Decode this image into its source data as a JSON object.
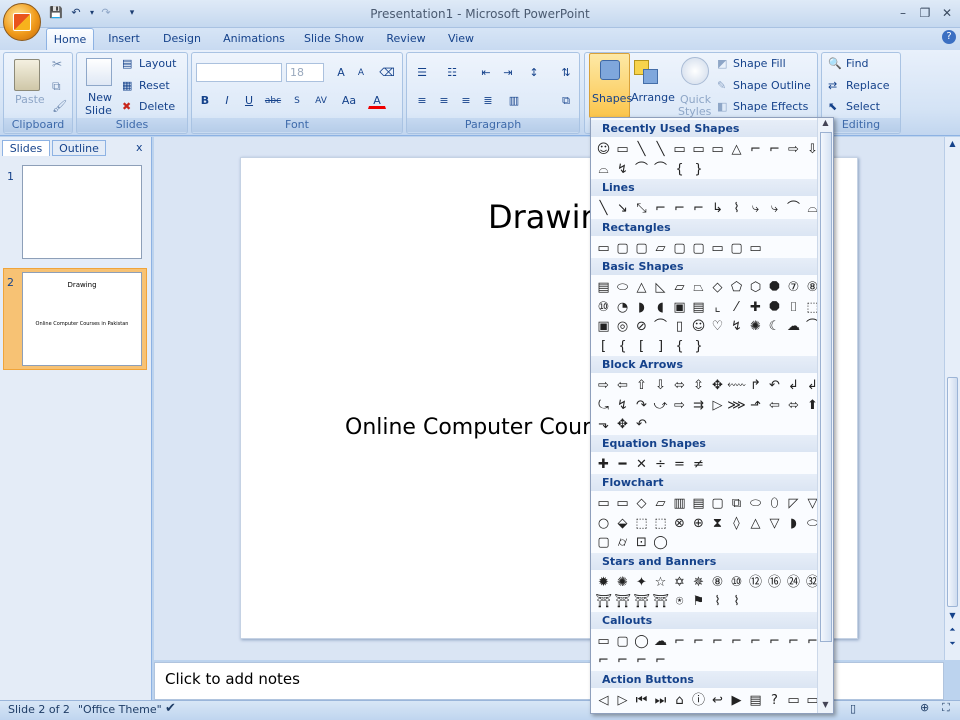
{
  "window": {
    "title": "Presentation1 - Microsoft PowerPoint"
  },
  "tabs": [
    "Home",
    "Insert",
    "Design",
    "Animations",
    "Slide Show",
    "Review",
    "View"
  ],
  "clipboard": {
    "paste": "Paste",
    "group": "Clipboard"
  },
  "slides_group": {
    "new_slide_1": "New",
    "new_slide_2": "Slide",
    "layout": "Layout",
    "reset": "Reset",
    "delete": "Delete",
    "group": "Slides"
  },
  "font": {
    "size": "18",
    "group": "Font",
    "bold": "B",
    "italic": "I",
    "underline": "U",
    "strike": "abc",
    "spacing": "AV",
    "case": "Aa",
    "grow": "A",
    "shrink": "A",
    "color": "A"
  },
  "paragraph": {
    "group": "Paragraph"
  },
  "drawing": {
    "shapes": "Shapes",
    "arrange": "Arrange",
    "quick_styles_1": "Quick",
    "quick_styles_2": "Styles",
    "fill": "Shape Fill",
    "outline": "Shape Outline",
    "effects": "Shape Effects"
  },
  "editing": {
    "find": "Find",
    "replace": "Replace",
    "select": "Select",
    "group": "Editing"
  },
  "pane": {
    "tab_slides": "Slides",
    "tab_outline": "Outline",
    "close": "x",
    "slide1_num": "1",
    "slide2_num": "2",
    "slide2_title": "Drawing",
    "slide2_sub": "Online Computer Courses in Pakistan"
  },
  "slide": {
    "title": "Drawin",
    "subtitle": "Online Computer Cour"
  },
  "notes": {
    "placeholder": "Click to add notes"
  },
  "status": {
    "slide": "Slide 2 of 2",
    "theme": "\"Office Theme\""
  },
  "gallery": {
    "categories": [
      {
        "name": "Recently Used Shapes",
        "rows": [
          [
            "☺",
            "▭",
            "╲",
            "╲",
            "▭",
            "▭",
            "▭",
            "△",
            "⌐",
            "⌐",
            "⇨",
            "⇩"
          ],
          [
            "⌓",
            "↯",
            "⌒",
            "⌒",
            "{",
            "}"
          ]
        ]
      },
      {
        "name": "Lines",
        "rows": [
          [
            "╲",
            "↘",
            "⤡",
            "⌐",
            "⌐",
            "⌐",
            "↳",
            "⌇",
            "⤷",
            "⤷",
            "⌒",
            "⌓",
            "↯"
          ]
        ]
      },
      {
        "name": "Rectangles",
        "rows": [
          [
            "▭",
            "▢",
            "▢",
            "▱",
            "▢",
            "▢",
            "▭",
            "▢",
            "▭"
          ]
        ]
      },
      {
        "name": "Basic Shapes",
        "rows": [
          [
            "▤",
            "⬭",
            "△",
            "◺",
            "▱",
            "⏢",
            "◇",
            "⬠",
            "⬡",
            "⯃",
            "⑦",
            "⑧"
          ],
          [
            "⑩",
            "◔",
            "◗",
            "◖",
            "▣",
            "▤",
            "⌞",
            "⁄",
            "✚",
            "⯃",
            "⌷",
            "⬚"
          ],
          [
            "▣",
            "◎",
            "⊘",
            "⌒",
            "▯",
            "☺",
            "♡",
            "↯",
            "✺",
            "☾",
            "☁",
            "⌒"
          ],
          [
            "[",
            "{",
            "[",
            "]",
            "{",
            "}"
          ]
        ]
      },
      {
        "name": "Block Arrows",
        "rows": [
          [
            "⇨",
            "⇦",
            "⇧",
            "⇩",
            "⬄",
            "⇳",
            "✥",
            "⬳",
            "↱",
            "↶",
            "↲",
            "↲"
          ],
          [
            "⤿",
            "↯",
            "↷",
            "⤻",
            "⇨",
            "⇉",
            "▷",
            "⋙",
            "⬏",
            "⇦",
            "⬄",
            "⬆"
          ],
          [
            "⬎",
            "✥",
            "↶"
          ]
        ]
      },
      {
        "name": "Equation Shapes",
        "rows": [
          [
            "✚",
            "━",
            "✕",
            "÷",
            "=",
            "≠"
          ]
        ]
      },
      {
        "name": "Flowchart",
        "rows": [
          [
            "▭",
            "▭",
            "◇",
            "▱",
            "▥",
            "▤",
            "▢",
            "⧉",
            "⬭",
            "⬯",
            "◸",
            "▽"
          ],
          [
            "○",
            "⬙",
            "⬚",
            "⬚",
            "⊗",
            "⊕",
            "⧗",
            "◊",
            "△",
            "▽",
            "◗",
            "⬭"
          ],
          [
            "▢",
            "⌭",
            "⊡",
            "◯"
          ]
        ]
      },
      {
        "name": "Stars and Banners",
        "rows": [
          [
            "✹",
            "✺",
            "✦",
            "☆",
            "✡",
            "✵",
            "⑧",
            "⑩",
            "⑫",
            "⑯",
            "㉔",
            "㉜"
          ],
          [
            "⛩",
            "⛩",
            "⛩",
            "⛩",
            "⍟",
            "⚑",
            "⌇",
            "⌇"
          ]
        ]
      },
      {
        "name": "Callouts",
        "rows": [
          [
            "▭",
            "▢",
            "◯",
            "☁",
            "⌐",
            "⌐",
            "⌐",
            "⌐",
            "⌐",
            "⌐",
            "⌐",
            "⌐"
          ],
          [
            "⌐",
            "⌐",
            "⌐",
            "⌐"
          ]
        ]
      },
      {
        "name": "Action Buttons",
        "rows": [
          [
            "◁",
            "▷",
            "⏮",
            "⏭",
            "⌂",
            "ⓘ",
            "↩",
            "▶",
            "▤",
            "?",
            "▭",
            "▭"
          ]
        ]
      }
    ]
  }
}
